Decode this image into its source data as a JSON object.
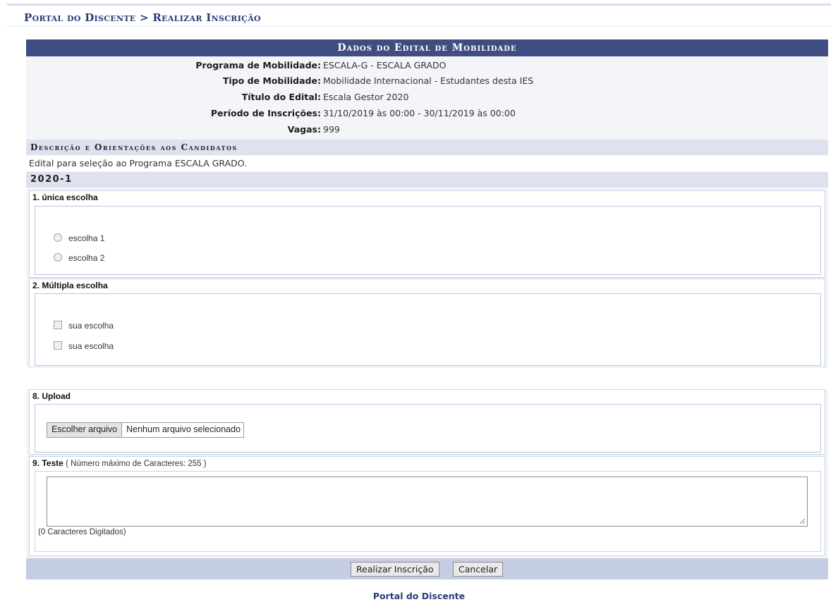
{
  "breadcrumb": "Portal do Discente > Realizar Inscrição",
  "panel_title": "Dados do Edital de Mobilidade",
  "info": [
    {
      "label": "Programa de Mobilidade:",
      "value": "ESCALA-G - ESCALA GRADO"
    },
    {
      "label": "Tipo de Mobilidade:",
      "value": "Mobilidade Internacional - Estudantes desta IES"
    },
    {
      "label": "Título do Edital:",
      "value": "Escala Gestor 2020"
    },
    {
      "label": "Período de Inscrições:",
      "value": "31/10/2019 às 00:00 - 30/11/2019 às 00:00"
    },
    {
      "label": "Vagas:",
      "value": "999"
    }
  ],
  "description_heading": "Descrição e Orientações aos Candidatos",
  "description_text": "Edital para seleção ao Programa ESCALA GRADO.",
  "period": "2020-1",
  "questions": {
    "q1": {
      "title": "1. única escolha",
      "options": [
        "escolha 1",
        "escolha 2"
      ]
    },
    "q2": {
      "title": "2. Múltipla escolha",
      "options": [
        "sua escolha",
        "sua escolha"
      ]
    },
    "q8": {
      "title": "8. Upload",
      "file_button": "Escolher arquivo",
      "file_status": "Nenhum arquivo selecionado"
    },
    "q9": {
      "title": "9. Teste",
      "hint": "( Número máximo de Caracteres: 255 )",
      "value": "",
      "counter": "(0 Caracteres Digitados)"
    }
  },
  "actions": {
    "submit": "Realizar Inscrição",
    "cancel": "Cancelar"
  },
  "footer_link": "Portal do Discente"
}
